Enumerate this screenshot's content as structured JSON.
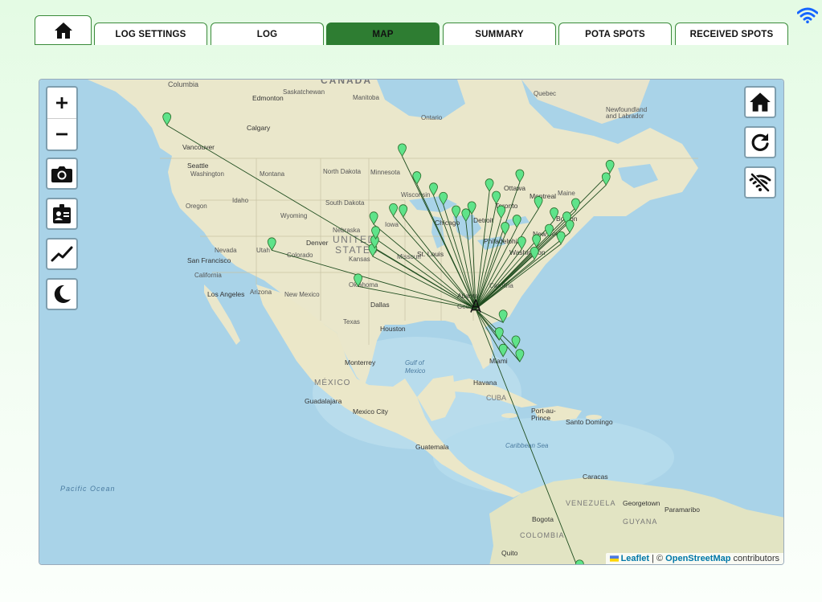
{
  "tabs": [
    {
      "label": "LOG SETTINGS",
      "active": false
    },
    {
      "label": "LOG",
      "active": false
    },
    {
      "label": "MAP",
      "active": true
    },
    {
      "label": "SUMMARY",
      "active": false
    },
    {
      "label": "POTA SPOTS",
      "active": false
    },
    {
      "label": "RECEIVED SPOTS",
      "active": false
    }
  ],
  "icons": {
    "home_tab": "home-icon",
    "status": "wifi-icon",
    "left_controls": [
      "zoom-in-icon",
      "zoom-out-icon",
      "camera-icon",
      "id-badge-icon",
      "chart-line-icon",
      "moon-icon"
    ],
    "right_controls": [
      "home-icon",
      "refresh-icon",
      "wifi-off-icon"
    ]
  },
  "colors": {
    "accent": "#2e7d32",
    "marker": "#5fe38a",
    "path": "#1f4d1f",
    "water": "#a9d3e8",
    "land": "#e9e6c9"
  },
  "attribution": {
    "leaflet": "Leaflet",
    "separator": " | © ",
    "osm": "OpenStreetMap",
    "suffix": " contributors"
  },
  "map_labels": {
    "countries": [
      "CANADA",
      "UNITED STATES",
      "MÉXICO",
      "CUBA",
      "VENEZUELA",
      "COLOMBIA",
      "GUYANA"
    ],
    "cities": [
      "Edmonton",
      "Calgary",
      "Vancouver",
      "Seattle",
      "San Francisco",
      "Los Angeles",
      "Denver",
      "Chicago",
      "Detroit",
      "Toronto",
      "Ottawa",
      "Montreal",
      "Boston",
      "New York",
      "Philadelphia",
      "Washington",
      "St. Louis",
      "Dallas",
      "Houston",
      "Atlanta",
      "Miami",
      "Monterrey",
      "Guadalajara",
      "Mexico City",
      "Havana",
      "Guatemala",
      "Port-au-Prince",
      "Santo Domingo",
      "Caracas",
      "Georgetown",
      "Paramaribo",
      "Bogota",
      "Quito"
    ],
    "regions": [
      "Saskatchewan",
      "Manitoba",
      "Ontario",
      "Quebec",
      "Newfoundland and Labrador",
      "Montana",
      "North Dakota",
      "South Dakota",
      "Minnesota",
      "Wisconsin",
      "Iowa",
      "Nebraska",
      "Wyoming",
      "Idaho",
      "Oregon",
      "Washington",
      "Nevada",
      "Utah",
      "Colorado",
      "Kansas",
      "Oklahoma",
      "Texas",
      "New Mexico",
      "Arizona",
      "California",
      "Missouri",
      "Georgia",
      "Carolina",
      "Maine"
    ],
    "water": [
      "Gulf of Mexico",
      "Caribbean Sea",
      "Pacific Ocean"
    ]
  },
  "home_station": {
    "lat": 30.4,
    "lon": -85.0
  },
  "contacts": [
    {
      "lat": 48.2,
      "lon": -116.5
    },
    {
      "lat": 36.1,
      "lon": -105.8
    },
    {
      "lat": 32.6,
      "lon": -97.0
    },
    {
      "lat": 35.5,
      "lon": -95.5
    },
    {
      "lat": 36.3,
      "lon": -95.3
    },
    {
      "lat": 37.2,
      "lon": -95.2
    },
    {
      "lat": 38.6,
      "lon": -95.4
    },
    {
      "lat": 39.4,
      "lon": -93.4
    },
    {
      "lat": 39.3,
      "lon": -92.4
    },
    {
      "lat": 45.2,
      "lon": -92.5
    },
    {
      "lat": 42.5,
      "lon": -91.0
    },
    {
      "lat": 41.4,
      "lon": -89.3
    },
    {
      "lat": 40.5,
      "lon": -88.3
    },
    {
      "lat": 39.2,
      "lon": -87.0
    },
    {
      "lat": 38.9,
      "lon": -86.0
    },
    {
      "lat": 39.6,
      "lon": -85.4
    },
    {
      "lat": 41.8,
      "lon": -83.6
    },
    {
      "lat": 40.6,
      "lon": -82.9
    },
    {
      "lat": 39.2,
      "lon": -82.4
    },
    {
      "lat": 37.6,
      "lon": -82.0
    },
    {
      "lat": 38.3,
      "lon": -80.8
    },
    {
      "lat": 36.2,
      "lon": -80.3
    },
    {
      "lat": 42.7,
      "lon": -80.5
    },
    {
      "lat": 40.1,
      "lon": -78.6
    },
    {
      "lat": 39.0,
      "lon": -77.0
    },
    {
      "lat": 38.6,
      "lon": -75.7
    },
    {
      "lat": 37.4,
      "lon": -77.5
    },
    {
      "lat": 37.8,
      "lon": -75.4
    },
    {
      "lat": 36.7,
      "lon": -76.3
    },
    {
      "lat": 36.4,
      "lon": -78.8
    },
    {
      "lat": 35.2,
      "lon": -79.0
    },
    {
      "lat": 39.9,
      "lon": -74.8
    },
    {
      "lat": 43.6,
      "lon": -71.3
    },
    {
      "lat": 42.4,
      "lon": -71.7
    },
    {
      "lat": 29.1,
      "lon": -82.2
    },
    {
      "lat": 27.4,
      "lon": -82.6
    },
    {
      "lat": 26.6,
      "lon": -80.9
    },
    {
      "lat": 25.8,
      "lon": -82.2
    },
    {
      "lat": 25.3,
      "lon": -80.5
    },
    {
      "lat": 4.9,
      "lon": -74.4
    }
  ]
}
